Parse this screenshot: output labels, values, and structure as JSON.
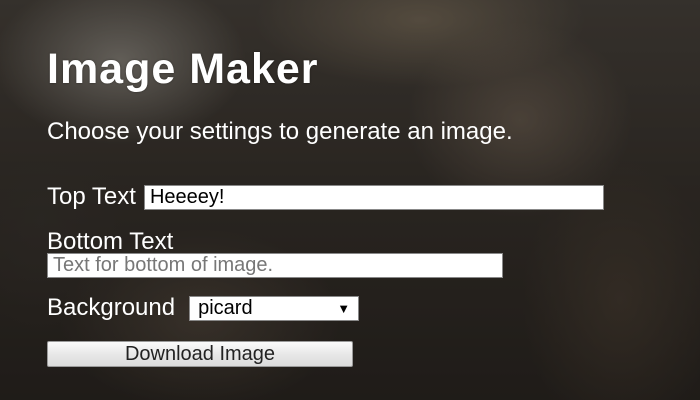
{
  "app": {
    "title": "Image Maker",
    "intro": "Choose your settings to generate an image."
  },
  "form": {
    "top_text_label": "Top Text",
    "top_text_value": "Heeeey!",
    "bottom_text_label": "Bottom Text",
    "bottom_text_value": "",
    "bottom_text_placeholder": "Text for bottom of image.",
    "background_label": "Background",
    "background_selected": "picard",
    "download_label": "Download Image"
  },
  "icons": {
    "dropdown": "chevron-down-icon"
  }
}
